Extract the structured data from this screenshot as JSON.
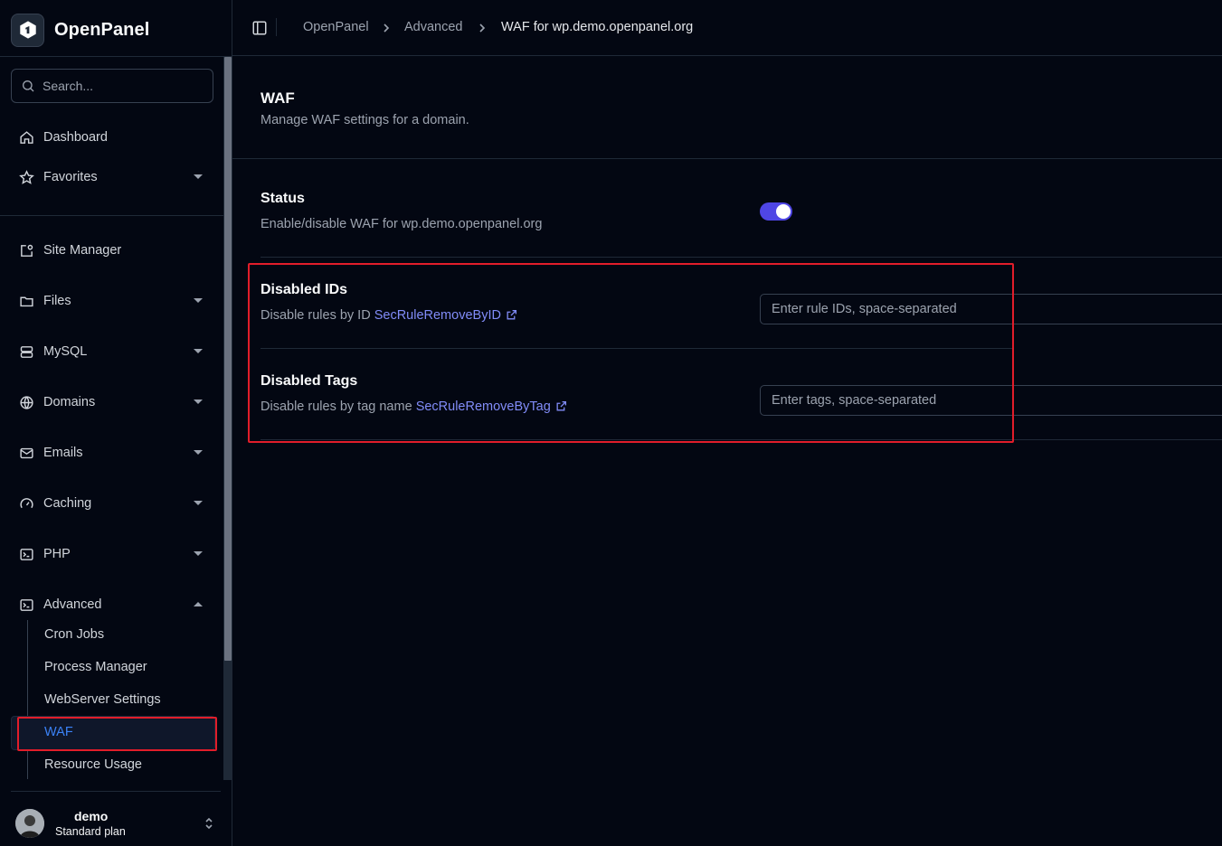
{
  "brand": {
    "name": "OpenPanel"
  },
  "search": {
    "placeholder": "Search..."
  },
  "nav": {
    "dashboard": "Dashboard",
    "favorites": "Favorites",
    "site_manager": "Site Manager",
    "files": "Files",
    "mysql": "MySQL",
    "domains": "Domains",
    "emails": "Emails",
    "caching": "Caching",
    "php": "PHP",
    "advanced": "Advanced",
    "advanced_children": [
      "Cron Jobs",
      "Process Manager",
      "WebServer Settings",
      "WAF",
      "Resource Usage"
    ],
    "active_child": "WAF"
  },
  "user": {
    "name": "demo",
    "plan": "Standard plan"
  },
  "breadcrumb": [
    "OpenPanel",
    "Advanced",
    "WAF for wp.demo.openpanel.org"
  ],
  "page": {
    "title": "WAF",
    "subtitle": "Manage WAF settings for a domain."
  },
  "settings": {
    "status": {
      "title": "Status",
      "desc": "Enable/disable WAF for wp.demo.openpanel.org",
      "enabled": true
    },
    "disabled_ids": {
      "title": "Disabled IDs",
      "desc": "Disable rules by ID",
      "link": "SecRuleRemoveByID",
      "placeholder": "Enter rule IDs, space-separated"
    },
    "disabled_tags": {
      "title": "Disabled Tags",
      "desc": "Disable rules by tag name",
      "link": "SecRuleRemoveByTag",
      "placeholder": "Enter tags, space-separated"
    }
  },
  "colors": {
    "accent": "#4f46e5",
    "link": "#818cf8",
    "highlight": "#e11d2a",
    "active_nav": "#3b82f6"
  }
}
